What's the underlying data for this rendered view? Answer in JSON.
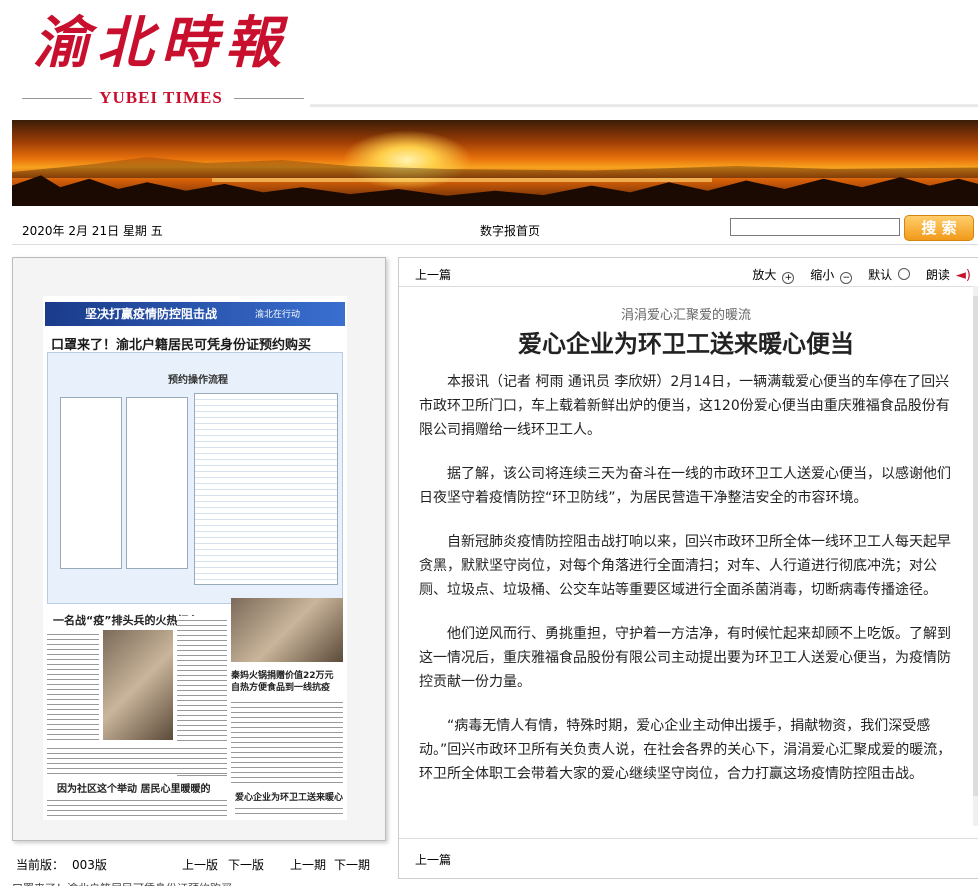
{
  "header": {
    "logo_cn": "渝北時報",
    "logo_en": "YUBEI TIMES"
  },
  "datebar": {
    "date": "2020年  2月  21日  星期  五",
    "home_link": "数字报首页",
    "search_placeholder": "",
    "search_button": "搜 索"
  },
  "thumb": {
    "page_no": "03",
    "banner_title": "坚决打赢疫情防控阻击战",
    "banner_sub": "渝北在行动",
    "headline": "口罩来了！渝北户籍居民可凭身份证预约购买",
    "box_caption": "预约操作流程",
    "sub1": "一名战“疫”排头兵的火热初心",
    "sub2": "秦妈火锅捐赠价值22万元\n自热方便食品到一线抗疫",
    "sub3": "因为社区这个举动  居民心里暖暖的",
    "sub4": "爱心企业为环卫工送来暖心便当"
  },
  "left_footer": {
    "current_label": "当前版：",
    "current_value": "003版",
    "prev_page": "上一版",
    "next_page": "下一版",
    "prev_issue": "上一期",
    "next_issue": "下一期"
  },
  "bottom_cut": "口罩来了！渝北户籍居民可凭身份证预约购买",
  "article_tools": {
    "prev": "上一篇",
    "zoom_in": "放大",
    "zoom_out": "缩小",
    "default": "默认",
    "read": "朗读"
  },
  "article": {
    "subtitle": "涓涓爱心汇聚爱的暖流",
    "title": "爱心企业为环卫工送来暖心便当",
    "paragraphs": [
      "本报讯（记者 柯雨 通讯员 李欣妍）2月14日，一辆满载爱心便当的车停在了回兴市政环卫所门口，车上载着新鲜出炉的便当，这120份爱心便当由重庆雅福食品股份有限公司捐赠给一线环卫工人。",
      "据了解，该公司将连续三天为奋斗在一线的市政环卫工人送爱心便当，以感谢他们日夜坚守着疫情防控“环卫防线”，为居民营造干净整洁安全的市容环境。",
      "自新冠肺炎疫情防控阻击战打响以来，回兴市政环卫所全体一线环卫工人每天起早贪黑，默默坚守岗位，对每个角落进行全面清扫；对车、人行道进行彻底冲洗；对公厕、垃圾点、垃圾桶、公交车站等重要区域进行全面杀菌消毒，切断病毒传播途径。",
      "他们逆风而行、勇挑重担，守护着一方洁净，有时候忙起来却顾不上吃饭。了解到这一情况后，重庆雅福食品股份有限公司主动提出要为环卫工人送爱心便当，为疫情防控贡献一份力量。",
      "“病毒无情人有情，特殊时期，爱心企业主动伸出援手，捐献物资，我们深受感动。”回兴市政环卫所有关负责人说，在社会各界的关心下，涓涓爱心汇聚成爱的暖流，环卫所全体职工会带着大家的爱心继续坚守岗位，合力打赢这场疫情防控阻击战。"
    ]
  },
  "article_bottom": {
    "prev": "上一篇"
  },
  "colors": {
    "brand_red": "#c8102e",
    "search_orange": "#f19a1a"
  }
}
